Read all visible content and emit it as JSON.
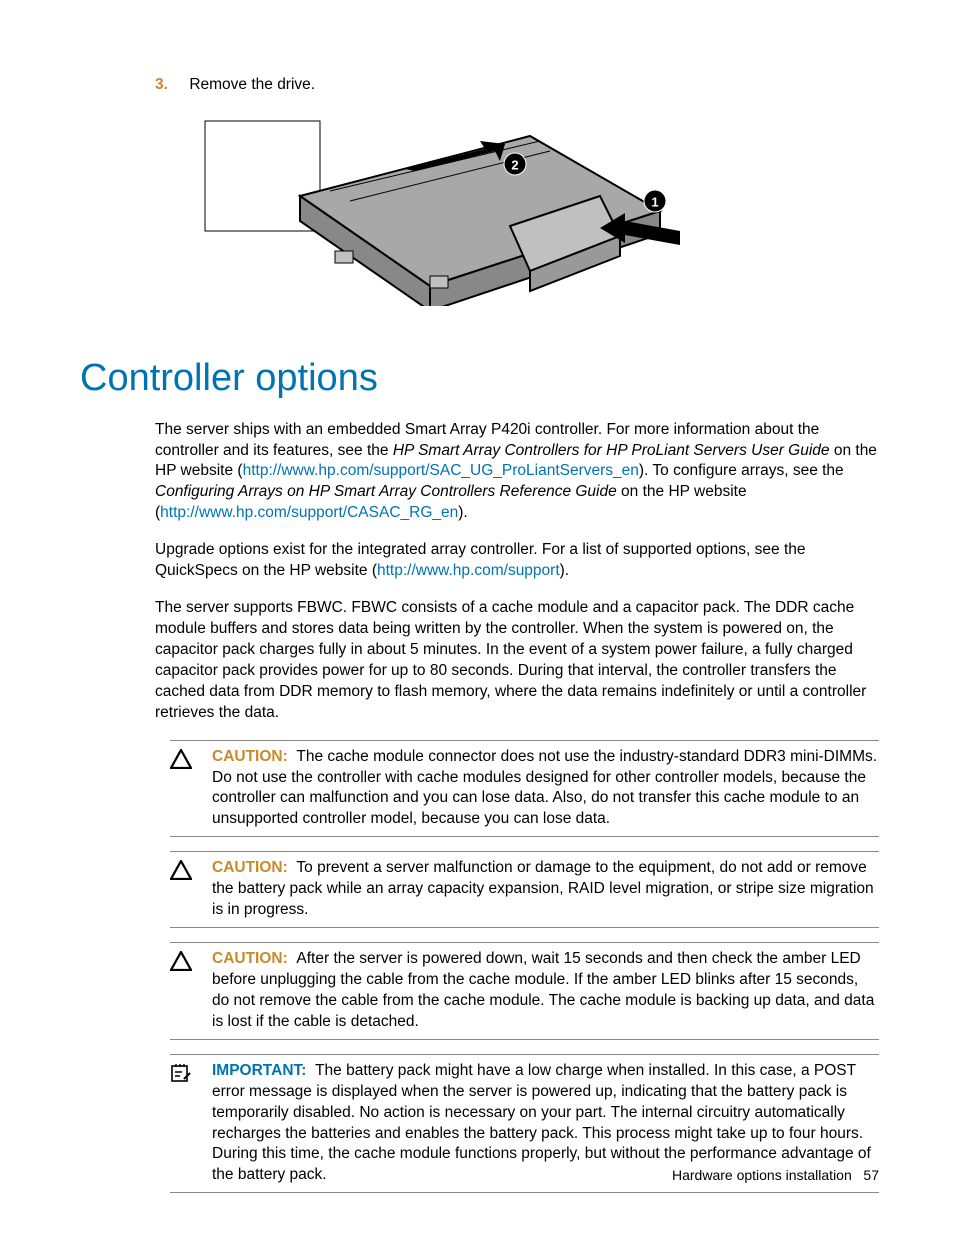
{
  "step": {
    "number": "3.",
    "text": "Remove the drive."
  },
  "figure": {
    "callout1": "1",
    "callout2": "2"
  },
  "section_title": "Controller options",
  "para1": {
    "t1": "The server ships with an embedded Smart Array P420i controller. For more information about the controller and its features, see the ",
    "i1": "HP Smart Array Controllers for HP ProLiant Servers User Guide",
    "t2": " on the HP website (",
    "l1": "http://www.hp.com/support/SAC_UG_ProLiantServers_en",
    "t3": "). To configure arrays, see the ",
    "i2": "Configuring Arrays on HP Smart Array Controllers Reference Guide",
    "t4": " on the HP website (",
    "l2": "http://www.hp.com/support/CASAC_RG_en",
    "t5": ")."
  },
  "para2": {
    "t1": "Upgrade options exist for the integrated array controller. For a list of supported options, see the QuickSpecs on the HP website (",
    "l1": "http://www.hp.com/support",
    "t2": ")."
  },
  "para3": "The server supports FBWC. FBWC consists of a cache module and a capacitor pack. The DDR cache module buffers and stores data being written by the controller. When the system is powered on, the capacitor pack charges fully in about 5 minutes. In the event of a system power failure, a fully charged capacitor pack provides power for up to 80 seconds. During that interval, the controller transfers the cached data from DDR memory to flash memory, where the data remains indefinitely or until a controller retrieves the data.",
  "caution1": {
    "label": "CAUTION:",
    "text": "The cache module connector does not use the industry-standard DDR3 mini-DIMMs. Do not use the controller with cache modules designed for other controller models, because the controller can malfunction and you can lose data. Also, do not transfer this cache module to an unsupported controller model, because you can lose data."
  },
  "caution2": {
    "label": "CAUTION:",
    "text": "To prevent a server malfunction or damage to the equipment, do not add or remove the battery pack while an array capacity expansion, RAID level migration, or stripe size migration is in progress."
  },
  "caution3": {
    "label": "CAUTION:",
    "text": "After the server is powered down, wait 15 seconds and then check the amber LED before unplugging the cable from the cache module. If the amber LED blinks after 15 seconds, do not remove the cable from the cache module. The cache module is backing up data, and data is lost if the cable is detached."
  },
  "important1": {
    "label": "IMPORTANT:",
    "text": "The battery pack might have a low charge when installed. In this case, a POST error message is displayed when the server is powered up, indicating that the battery pack is temporarily disabled. No action is necessary on your part. The internal circuitry automatically recharges the batteries and enables the battery pack. This process might take up to four hours. During this time, the cache module functions properly, but without the performance advantage of the battery pack."
  },
  "footer": {
    "section": "Hardware options installation",
    "page": "57"
  }
}
